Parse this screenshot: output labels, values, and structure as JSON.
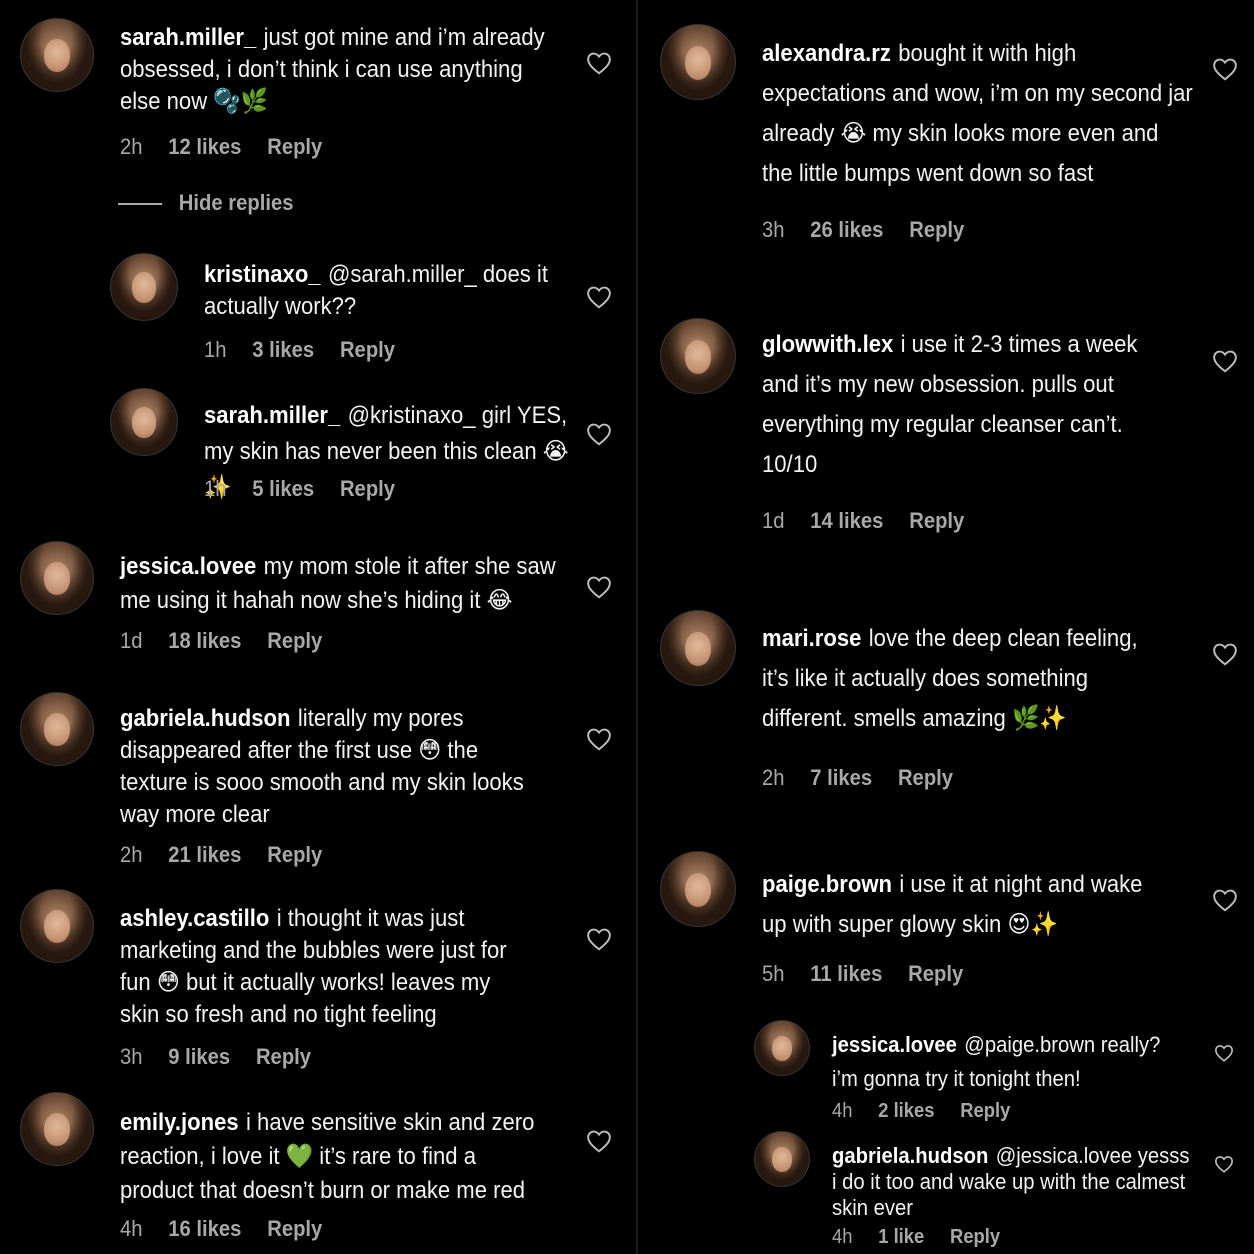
{
  "left_comments": [
    {
      "user": "sarah.miller_",
      "text": "just got mine and i’m already obsessed, i don’t think i can use anything else now 🫧🌿",
      "time": "2h",
      "likes": "12 likes",
      "reply": "Reply"
    },
    {
      "user": "kristinaxo_",
      "text": "@sarah.miller_ does it actually work??",
      "time": "1h",
      "likes": "3 likes",
      "reply": "Reply"
    },
    {
      "user": "sarah.miller_",
      "text": "@kristinaxo_ girl YES, my skin has never been this clean 😭✨",
      "time": "1h",
      "likes": "5 likes",
      "reply": "Reply"
    },
    {
      "user": "jessica.lovee",
      "text": "my mom stole it after she saw me using it hahah now she’s hiding it 😂",
      "time": "1d",
      "likes": "18 likes",
      "reply": "Reply"
    },
    {
      "user": "gabriela.hudson",
      "text": "literally my pores disappeared after the first use 😳 the texture is sooo smooth and my skin looks way more clear",
      "time": "2h",
      "likes": "21 likes",
      "reply": "Reply"
    },
    {
      "user": "ashley.castillo",
      "text": "i thought it was just marketing and the bubbles were just for fun 😳 but it actually works! leaves my skin so fresh and no tight feeling",
      "time": "3h",
      "likes": "9 likes",
      "reply": "Reply"
    },
    {
      "user": "emily.jones",
      "text": "i have sensitive skin and zero reaction, i love it 💚 it’s rare to find a product that doesn’t burn or make me red",
      "time": "4h",
      "likes": "16 likes",
      "reply": "Reply"
    }
  ],
  "hide_replies": "Hide replies",
  "right_comments": [
    {
      "user": "alexandra.rz",
      "text": "bought it with high expectations and wow, i’m on my second jar already 😭 my skin looks more even and the little bumps went down so fast",
      "time": "3h",
      "likes": "26 likes",
      "reply": "Reply"
    },
    {
      "user": "glowwith.lex",
      "text": "i use it 2-3 times a week and it’s my new obsession. pulls out everything my regular cleanser can’t. 10/10",
      "time": "1d",
      "likes": "14 likes",
      "reply": "Reply"
    },
    {
      "user": "mari.rose",
      "text": "love the deep clean feeling, it’s like it actually does something different. smells amazing 🌿✨",
      "time": "2h",
      "likes": "7 likes",
      "reply": "Reply"
    },
    {
      "user": "paige.brown",
      "text": "i use it at night and wake up with super glowy skin 😍✨",
      "time": "5h",
      "likes": "11 likes",
      "reply": "Reply"
    },
    {
      "user": "jessica.lovee",
      "text": "@paige.brown really? i’m gonna try it tonight then!",
      "time": "4h",
      "likes": "2 likes",
      "reply": "Reply"
    },
    {
      "user": "gabriela.hudson",
      "text": "@jessica.lovee yesss i do it too and wake up with the calmest skin ever",
      "time": "4h",
      "likes": "1 like",
      "reply": "Reply"
    }
  ],
  "colors": {
    "background": "#000000",
    "text": "#f2f2f2",
    "meta": "#a8a8a8"
  }
}
